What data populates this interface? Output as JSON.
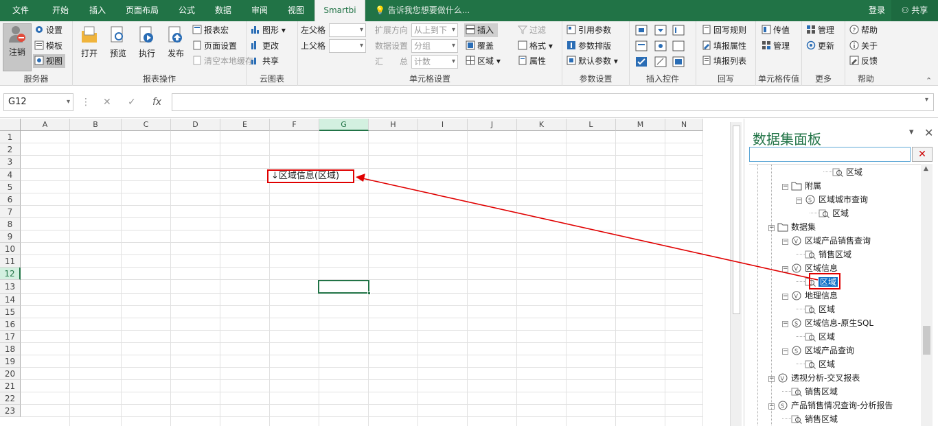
{
  "menu": {
    "tabs": [
      "文件",
      "开始",
      "插入",
      "页面布局",
      "公式",
      "数据",
      "审阅",
      "视图",
      "Smartbi"
    ],
    "active": "Smartbi",
    "tell_me": "告诉我您想要做什么...",
    "login": "登录",
    "share": "共享"
  },
  "ribbon": {
    "server": {
      "label": "服务器",
      "logout": "注销",
      "settings": "设置",
      "template": "模板",
      "view": "视图"
    },
    "report_ops": {
      "label": "报表操作",
      "open": "打开",
      "preview": "预览",
      "execute": "执行",
      "publish": "发布",
      "report_macro": "报表宏",
      "page_setup": "页面设置",
      "clear_cache": "清空本地缓存"
    },
    "cloud_chart": {
      "label": "云图表",
      "graph": "图形",
      "change": "更改",
      "share": "共享"
    },
    "cell_settings": {
      "label": "单元格设置",
      "left_parent": "左父格",
      "top_parent": "上父格",
      "expand_dir": "扩展方向",
      "expand_dir_value": "从上到下",
      "data_setting": "数据设置",
      "data_setting_value": "分组",
      "summary": "汇　　总",
      "summary_value": "计数",
      "insert": "插入",
      "overwrite": "覆盖",
      "region": "区域"
    },
    "filter": {
      "filter": "过滤",
      "format": "格式",
      "attribute": "属性"
    },
    "params": {
      "label": "参数设置",
      "ref_param": "引用参数",
      "param_layout": "参数排版",
      "default_param": "默认参数"
    },
    "controls": {
      "label": "插入控件"
    },
    "writeback": {
      "label": "回写",
      "rules": "回写规则",
      "fill_attr": "填报属性",
      "fill_list": "填报列表"
    },
    "cell_pass": {
      "label": "单元格传值",
      "pass_value": "传值",
      "manage": "管理"
    },
    "more": {
      "label": "更多",
      "manage": "管理",
      "update": "更新"
    },
    "help": {
      "label": "帮助",
      "help": "帮助",
      "about": "关于",
      "feedback": "反馈"
    }
  },
  "formula_bar": {
    "name_box": "G12",
    "fx": "fx",
    "value": ""
  },
  "sheet": {
    "columns": [
      "A",
      "B",
      "C",
      "D",
      "E",
      "F",
      "G",
      "H",
      "I",
      "J",
      "K",
      "L",
      "M",
      "N"
    ],
    "selected_col": "G",
    "rows": [
      "1",
      "2",
      "3",
      "4",
      "5",
      "6",
      "7",
      "8",
      "9",
      "10",
      "11",
      "12",
      "13",
      "14",
      "15",
      "16",
      "17",
      "18",
      "19",
      "20",
      "21",
      "22",
      "23"
    ],
    "selected_row": "12",
    "cell_f3": "↓区域信息(区域)"
  },
  "panel": {
    "title": "数据集面板",
    "tree": [
      {
        "label": "区域",
        "depth": 5,
        "icon": "field",
        "toggle": ""
      },
      {
        "label": "附属",
        "depth": 2,
        "icon": "folder",
        "toggle": "−"
      },
      {
        "label": "区域城市查询",
        "depth": 3,
        "icon": "sql",
        "toggle": "−"
      },
      {
        "label": "区域",
        "depth": 4,
        "icon": "field",
        "toggle": ""
      },
      {
        "label": "数据集",
        "depth": 1,
        "icon": "folder",
        "toggle": "−"
      },
      {
        "label": "区域产品销售查询",
        "depth": 2,
        "icon": "view",
        "toggle": "−"
      },
      {
        "label": "销售区域",
        "depth": 3,
        "icon": "field",
        "toggle": ""
      },
      {
        "label": "区域信息",
        "depth": 2,
        "icon": "view",
        "toggle": "−"
      },
      {
        "label": "区域",
        "depth": 3,
        "icon": "field",
        "toggle": "",
        "selected": true
      },
      {
        "label": "地理信息",
        "depth": 2,
        "icon": "view",
        "toggle": "−"
      },
      {
        "label": "区域",
        "depth": 3,
        "icon": "field",
        "toggle": ""
      },
      {
        "label": "区域信息-原生SQL",
        "depth": 2,
        "icon": "sql",
        "toggle": "−"
      },
      {
        "label": "区域",
        "depth": 3,
        "icon": "field",
        "toggle": ""
      },
      {
        "label": "区域产品查询",
        "depth": 2,
        "icon": "sql",
        "toggle": "−"
      },
      {
        "label": "区域",
        "depth": 3,
        "icon": "field",
        "toggle": ""
      },
      {
        "label": "透视分析-交叉报表",
        "depth": 1,
        "icon": "view",
        "toggle": "−"
      },
      {
        "label": "销售区域",
        "depth": 2,
        "icon": "field",
        "toggle": ""
      },
      {
        "label": "产品销售情况查询-分析报告",
        "depth": 1,
        "icon": "sql",
        "toggle": "−"
      },
      {
        "label": "销售区域",
        "depth": 2,
        "icon": "field",
        "toggle": ""
      }
    ]
  },
  "colors": {
    "accent": "#217346",
    "highlight": "#e00000",
    "selected": "#0f6fc6"
  }
}
